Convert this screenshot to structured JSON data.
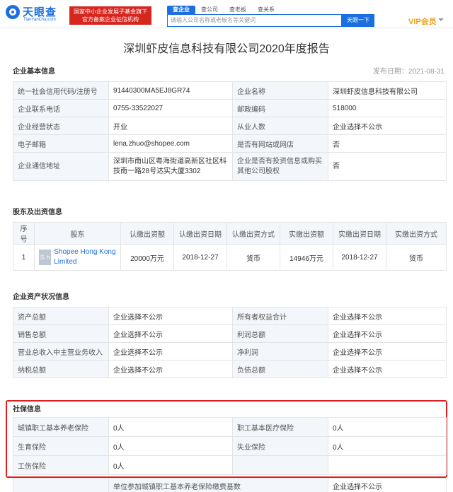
{
  "header": {
    "logo_text": "天眼查",
    "logo_sub": "TianYanCha.com",
    "badge_line1": "国家中小企业发展子基金旗下",
    "badge_line2": "官方备案企业征信机构",
    "tabs": [
      {
        "label": "查企业",
        "active": true
      },
      {
        "label": "查公司",
        "active": false
      },
      {
        "label": "查老板",
        "active": false
      },
      {
        "label": "查关系",
        "active": false
      }
    ],
    "search_placeholder": "请输入公司名称或老板名等关键词",
    "search_button": "天眼一下",
    "vip_label": "VIP会员"
  },
  "report": {
    "title": "深圳虾皮信息科技有限公司2020年度报告",
    "publish_date": "发布日期：2021-08-31"
  },
  "basic": {
    "section_title": "企业基本信息",
    "rows": [
      {
        "l1": "统一社会信用代码/注册号",
        "v1": "91440300MA5EJ8GR74",
        "l2": "企业名称",
        "v2": "深圳虾皮信息科技有限公司"
      },
      {
        "l1": "企业联系电话",
        "v1": "0755-33522027",
        "l2": "邮政编码",
        "v2": "518000"
      },
      {
        "l1": "企业经营状态",
        "v1": "开业",
        "l2": "从业人数",
        "v2": "企业选择不公示"
      },
      {
        "l1": "电子邮箱",
        "v1": "lena.zhuo@shopee.com",
        "l2": "是否有网站或网店",
        "v2": "否"
      },
      {
        "l1": "企业通信地址",
        "v1": "深圳市南山区粤海街道高新区社区科技南一路28号达实大厦3302",
        "l2": "企业是否有投资信息或购买其他公司股权",
        "v2": "否"
      }
    ]
  },
  "shareholders": {
    "section_title": "股东及出资信息",
    "headers": [
      "序号",
      "股东",
      "认缴出资额",
      "认缴出资日期",
      "认缴出资方式",
      "实缴出资额",
      "实缴出资日期",
      "实缴出资方式"
    ],
    "rows": [
      {
        "index": "1",
        "avatar": "S h",
        "name": "Shopee Hong Kong Limited",
        "sub_amount": "20000万元",
        "sub_date": "2018-12-27",
        "sub_method": "货币",
        "paid_amount": "14946万元",
        "paid_date": "2018-12-27",
        "paid_method": "货币"
      }
    ]
  },
  "assets": {
    "section_title": "企业资产状况信息",
    "rows": [
      {
        "l1": "资产总额",
        "v1": "企业选择不公示",
        "l2": "所有者权益合计",
        "v2": "企业选择不公示"
      },
      {
        "l1": "销售总额",
        "v1": "企业选择不公示",
        "l2": "利润总额",
        "v2": "企业选择不公示"
      },
      {
        "l1": "营业总收入中主营业务收入",
        "v1": "企业选择不公示",
        "l2": "净利润",
        "v2": "企业选择不公示"
      },
      {
        "l1": "纳税总额",
        "v1": "企业选择不公示",
        "l2": "负债总额",
        "v2": "企业选择不公示"
      }
    ]
  },
  "social": {
    "section_title": "社保信息",
    "rows": [
      {
        "l1": "城镇职工基本养老保险",
        "v1": "0人",
        "l2": "职工基本医疗保险",
        "v2": "0人"
      },
      {
        "l1": "生育保险",
        "v1": "0人",
        "l2": "失业保险",
        "v2": "0人"
      },
      {
        "l1": "工伤保险",
        "v1": "0人",
        "l2": "",
        "v2": ""
      }
    ],
    "footer_label": "单位参加城镇职工基本养老保险缴费基数",
    "footer_value": "企业选择不公示"
  },
  "colors": {
    "brand": "#1d6fe0",
    "badge": "#d7261e",
    "vip": "#f4a01a",
    "highlight_frame": "#e0201f"
  }
}
